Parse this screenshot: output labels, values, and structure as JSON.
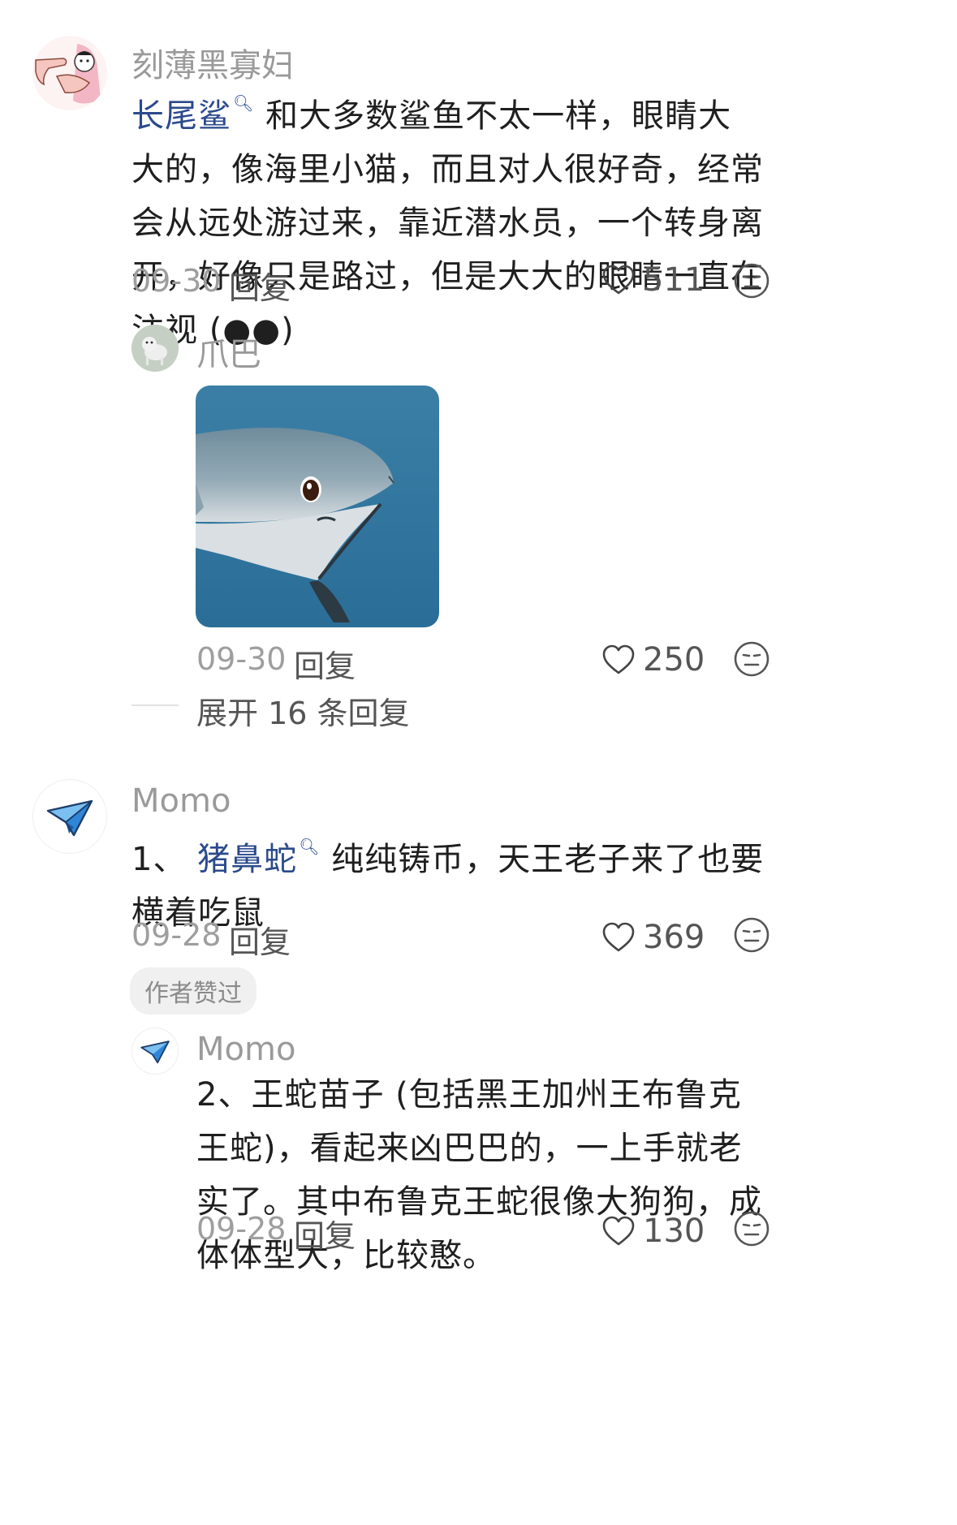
{
  "comments": [
    {
      "username": "刻薄黑寡妇",
      "link_text": "长尾鲨",
      "search_mark": "Q",
      "text": "和大多数鲨鱼不太一样，眼睛大大的，像海里小猫，而且对人很好奇，经常会从远处游过来，靠近潜水员，一个转身离开，好像只是路过，但是大大的眼睛一直在注视 (●●)",
      "date": "09-30",
      "reply_label": "回复",
      "likes": "511",
      "replies": [
        {
          "username": "爪巴",
          "date": "09-30",
          "reply_label": "回复",
          "likes": "250"
        }
      ],
      "expand_label": "展开 16 条回复"
    },
    {
      "username": "Momo",
      "prefix": "1、",
      "link_text": "猪鼻蛇",
      "search_mark": "Q",
      "text": "纯纯铸币，天王老子来了也要横着吃鼠",
      "date": "09-28",
      "reply_label": "回复",
      "likes": "369",
      "badge": "作者赞过",
      "replies": [
        {
          "username": "Momo",
          "text": "2、王蛇苗子 (包括黑王加州王布鲁克王蛇)，看起来凶巴巴的，一上手就老实了。其中布鲁克王蛇很像大狗狗，成体体型大，比较憨。",
          "date": "09-28",
          "reply_label": "回复",
          "likes": "130"
        }
      ]
    }
  ],
  "icons": {
    "like": "heart-outline-icon",
    "emoji": "neutral-face-icon",
    "avatar_momo": "paper-plane-icon"
  },
  "colors": {
    "link": "#2b4a8c",
    "muted": "#9a9a9a",
    "text": "#1f1f1f"
  }
}
